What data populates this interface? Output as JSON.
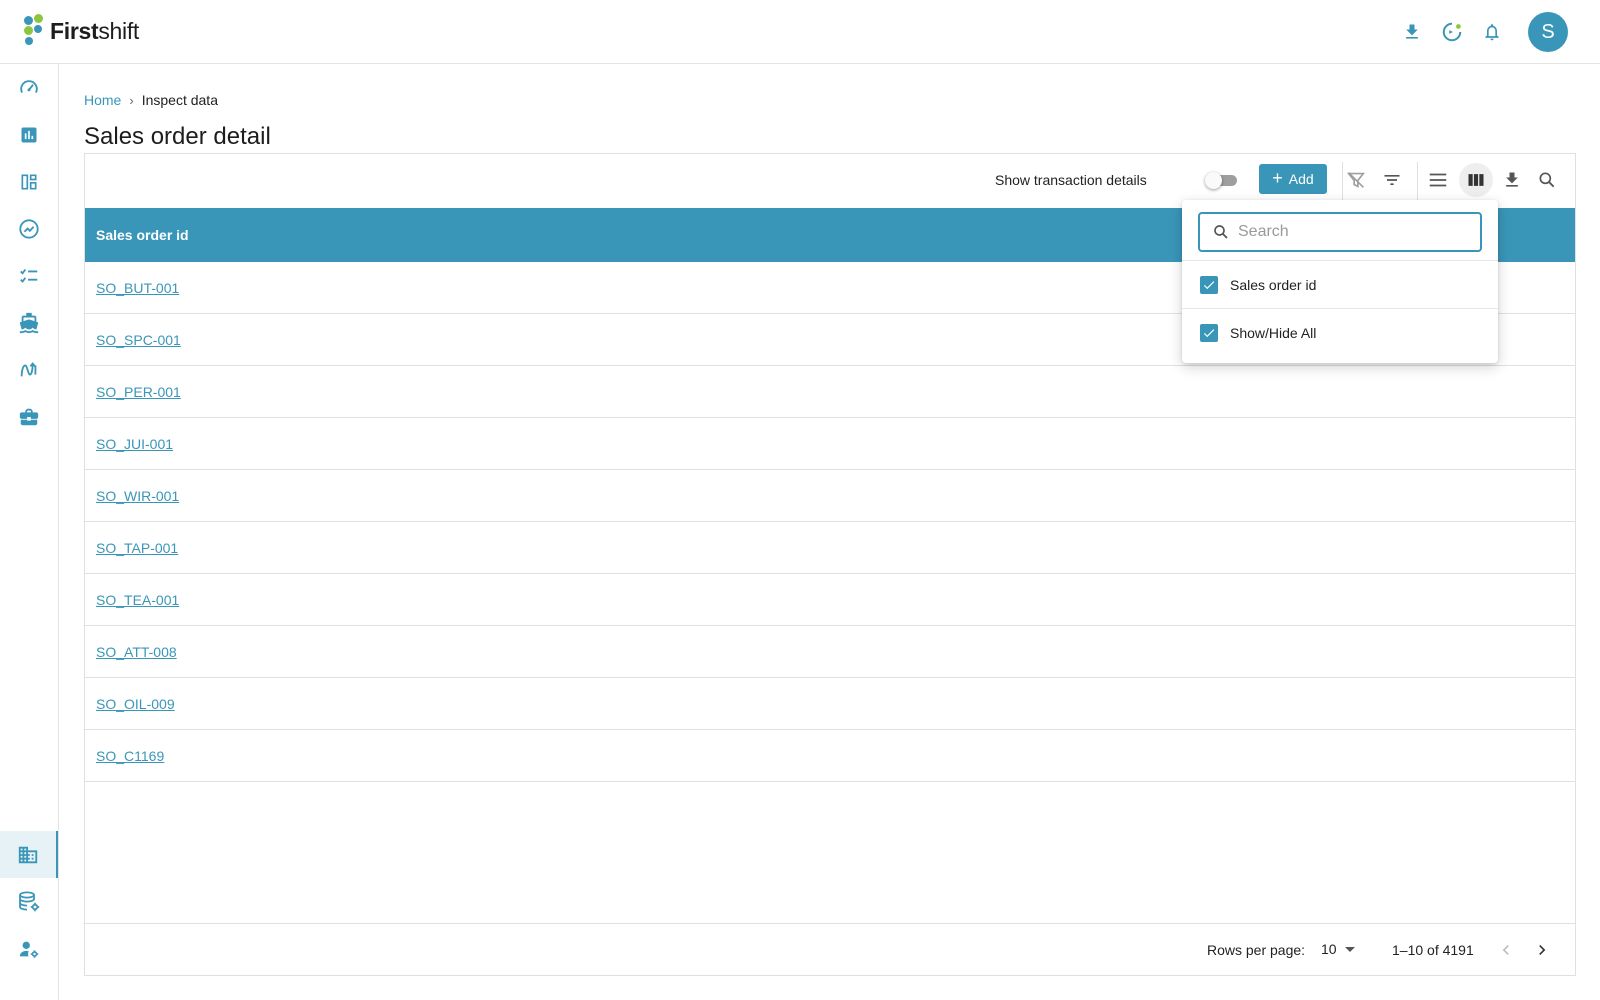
{
  "app": {
    "brand_bold": "First",
    "brand_light": "shift",
    "avatar_initial": "S",
    "accent_color": "#3a96b9"
  },
  "topbar": {
    "icons": [
      "download-icon",
      "status-icon",
      "bell-icon"
    ]
  },
  "sidebar": {
    "items": [
      {
        "icon": "gauge-icon"
      },
      {
        "icon": "bar-chart-icon"
      },
      {
        "icon": "dashboard-icon"
      },
      {
        "icon": "trend-icon"
      },
      {
        "icon": "checklist-icon"
      },
      {
        "icon": "ship-icon"
      },
      {
        "icon": "flow-icon"
      },
      {
        "icon": "briefcase-icon"
      },
      {
        "icon": "building-icon",
        "active": true
      },
      {
        "icon": "database-settings-icon"
      },
      {
        "icon": "user-settings-icon"
      }
    ]
  },
  "breadcrumb": {
    "home": "Home",
    "separator": "›",
    "current": "Inspect data"
  },
  "page": {
    "title": "Sales order detail"
  },
  "toolbar": {
    "toggle_label": "Show transaction details",
    "toggle_on": false,
    "add_label": "Add"
  },
  "table": {
    "columns": [
      "Sales order id"
    ],
    "rows": [
      "SO_BUT-001",
      "SO_SPC-001",
      "SO_PER-001",
      "SO_JUI-001",
      "SO_WIR-001",
      "SO_TAP-001",
      "SO_TEA-001",
      "SO_ATT-008",
      "SO_OIL-009",
      "SO_C1169"
    ]
  },
  "pagination": {
    "rows_per_page_label": "Rows per page:",
    "rows_per_page": "10",
    "range": "1–10 of 4191"
  },
  "column_menu": {
    "search_placeholder": "Search",
    "items": [
      {
        "label": "Sales order id",
        "checked": true
      },
      {
        "label": "Show/Hide All",
        "checked": true
      }
    ]
  }
}
